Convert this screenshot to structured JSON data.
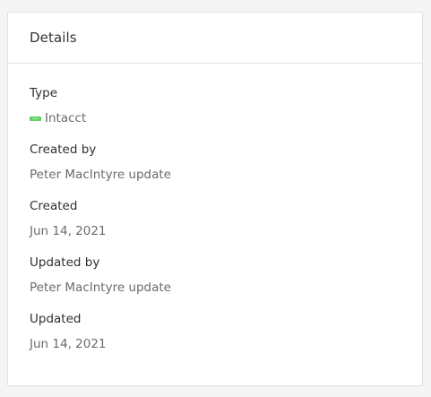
{
  "card": {
    "title": "Details"
  },
  "fields": [
    {
      "label": "Type",
      "value": "Intacct",
      "logo": "intacct-logo-icon"
    },
    {
      "label": "Created by",
      "value": "Peter MacIntyre update"
    },
    {
      "label": "Created",
      "value": "Jun 14, 2021"
    },
    {
      "label": "Updated by",
      "value": "Peter MacIntyre update"
    },
    {
      "label": "Updated",
      "value": "Jun 14, 2021"
    }
  ],
  "colors": {
    "logo_green": "#5fd35f",
    "label_text": "#2f2f2f",
    "value_text": "#6b6b6b",
    "card_border": "#e0e0e0",
    "page_background": "#f5f5f5"
  }
}
